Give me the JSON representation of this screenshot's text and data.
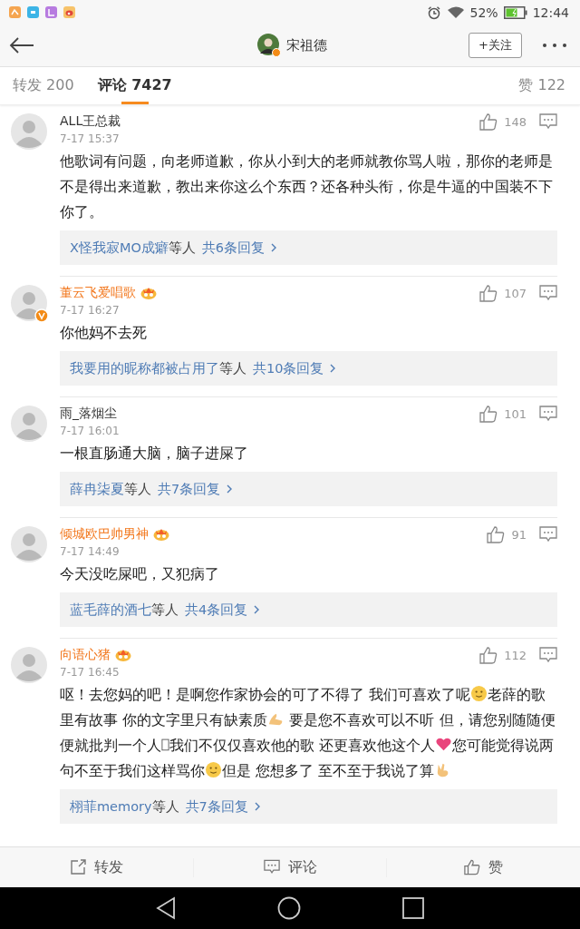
{
  "status_bar": {
    "battery": "52%",
    "time": "12:44"
  },
  "header": {
    "title": "宋祖德",
    "verified": true,
    "follow_button": "+关注"
  },
  "tabs": [
    {
      "label": "转发 200",
      "selected": false
    },
    {
      "label": "评论 7427",
      "selected": true
    },
    {
      "label": "赞 122",
      "selected": false
    }
  ],
  "comments": [
    {
      "name": "ALL王总裁",
      "vip": false,
      "verified": false,
      "time": "7-17 15:37",
      "likes": "148",
      "body": [
        {
          "kind": "text",
          "text": "他歌词有问题，向老师道歉，你从小到大的老师就教你骂人啦，那你的老师是不是得出来道歉，教出来你这么个东西？还各种头衔，你是牛逼的中国装不下你了。"
        }
      ],
      "replies": {
        "users": "X怪我寂MO成癖",
        "suffix": "等人",
        "total": "共6条回复"
      }
    },
    {
      "name": "董云飞爱唱歌",
      "vip": true,
      "verified": true,
      "time": "7-17 16:27",
      "likes": "107",
      "body": [
        {
          "kind": "text",
          "text": "你他妈不去死"
        }
      ],
      "replies": {
        "users": "我要用的昵称都被占用了",
        "suffix": "等人",
        "total": "共10条回复"
      }
    },
    {
      "name": "雨_落烟尘",
      "vip": false,
      "verified": false,
      "time": "7-17 16:01",
      "likes": "101",
      "body": [
        {
          "kind": "text",
          "text": "一根直肠通大脑，脑子进屎了"
        }
      ],
      "replies": {
        "users": "薛冉柒夏",
        "suffix": "等人",
        "total": "共7条回复"
      }
    },
    {
      "name": "倾城欧巴帅男神",
      "vip": true,
      "verified": false,
      "time": "7-17 14:49",
      "likes": "91",
      "body": [
        {
          "kind": "text",
          "text": "今天没吃屎吧，又犯病了"
        }
      ],
      "replies": {
        "users": "蓝毛薛的酒七",
        "suffix": "等人",
        "total": "共4条回复"
      }
    },
    {
      "name": "向语心猪",
      "vip": true,
      "verified": false,
      "time": "7-17 16:45",
      "likes": "112",
      "body": [
        {
          "kind": "text",
          "text": "呕！去您妈的吧！是啊您作家协会的可了不得了 我们可喜欢了呢"
        },
        {
          "kind": "face"
        },
        {
          "kind": "text",
          "text": "老薛的歌里有故事 你的文字里只有缺素质"
        },
        {
          "kind": "hands"
        },
        {
          "kind": "text",
          "text": " 要是您不喜欢可以不听 但，请您别随随便便就批判一个人"
        },
        {
          "kind": "tofu"
        },
        {
          "kind": "text",
          "text": "我们不仅仅喜欢他的歌 还更喜欢他这个人"
        },
        {
          "kind": "heart"
        },
        {
          "kind": "text",
          "text": "您可能觉得说两句不至于我们这样骂你"
        },
        {
          "kind": "face"
        },
        {
          "kind": "text",
          "text": "但是 您想多了 至不至于我说了算"
        },
        {
          "kind": "victory"
        }
      ],
      "replies": {
        "users": "栩菲memory",
        "suffix": "等人",
        "total": "共7条回复"
      }
    }
  ],
  "bottom_bar": [
    {
      "kind": "repost",
      "label": "转发"
    },
    {
      "kind": "comment",
      "label": "评论"
    },
    {
      "kind": "like",
      "label": "赞"
    }
  ]
}
